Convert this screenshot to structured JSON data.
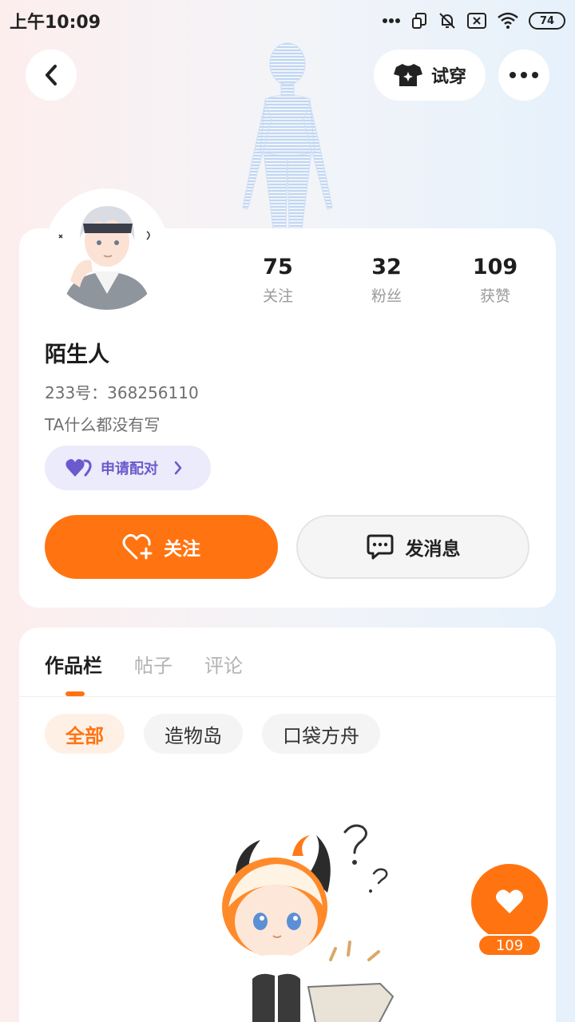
{
  "status_bar": {
    "time": "上午10:09",
    "battery": "74",
    "icons": [
      "dots-icon",
      "screen-rotate-icon",
      "mute-icon",
      "sim-off-icon",
      "wifi-icon",
      "battery-icon"
    ]
  },
  "nav": {
    "back_icon": "chevron-left-icon",
    "try_on_label": "试穿",
    "try_on_icon": "tshirt-icon",
    "more_icon": "more-dots-icon"
  },
  "profile": {
    "stats": [
      {
        "value": "75",
        "label": "关注"
      },
      {
        "value": "32",
        "label": "粉丝"
      },
      {
        "value": "109",
        "label": "获赞"
      }
    ],
    "nickname": "陌生人",
    "uid": "233号：368256110",
    "bio": "TA什么都没有写",
    "pair_label": "申请配对",
    "follow_label": "关注",
    "message_label": "发消息"
  },
  "works": {
    "tabs": [
      {
        "label": "作品栏",
        "active": true
      },
      {
        "label": "帖子",
        "active": false
      },
      {
        "label": "评论",
        "active": false
      }
    ],
    "filters": [
      {
        "label": "全部",
        "active": true
      },
      {
        "label": "造物岛",
        "active": false
      },
      {
        "label": "口袋方舟",
        "active": false
      }
    ]
  },
  "like_fab": {
    "count": "109"
  },
  "colors": {
    "accent": "#ff7411",
    "pair_bg": "#ebebfb",
    "pair_text": "#6a5acd"
  }
}
